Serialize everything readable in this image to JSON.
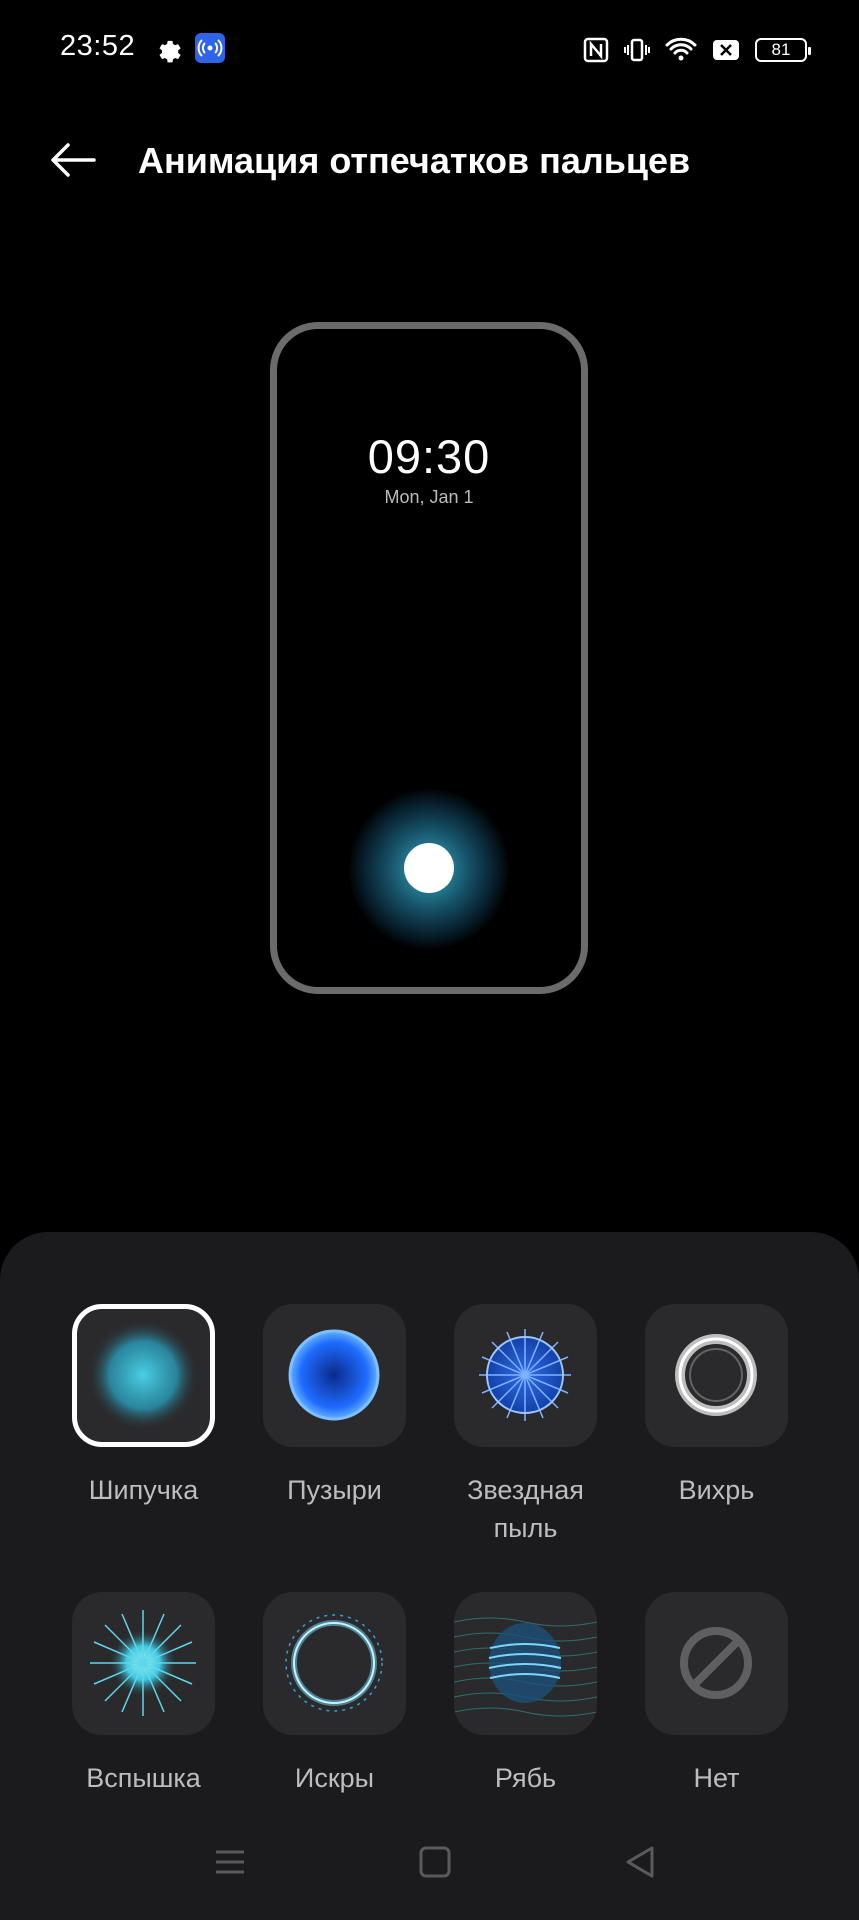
{
  "status_bar": {
    "time": "23:52",
    "battery": "81"
  },
  "header": {
    "title": "Анимация отпечатков пальцев"
  },
  "preview": {
    "time": "09:30",
    "date": "Mon, Jan 1"
  },
  "options": [
    {
      "label": "Шипучка",
      "icon": "fizz-animation-icon",
      "selected": true
    },
    {
      "label": "Пузыри",
      "icon": "bubble-animation-icon",
      "selected": false
    },
    {
      "label": "Звездная пыль",
      "icon": "stardust-animation-icon",
      "selected": false
    },
    {
      "label": "Вихрь",
      "icon": "vortex-animation-icon",
      "selected": false
    },
    {
      "label": "Вспышка",
      "icon": "flash-animation-icon",
      "selected": false
    },
    {
      "label": "Искры",
      "icon": "sparks-animation-icon",
      "selected": false
    },
    {
      "label": "Рябь",
      "icon": "ripple-animation-icon",
      "selected": false
    },
    {
      "label": "Нет",
      "icon": "none-icon",
      "selected": false
    }
  ],
  "colors": {
    "accent_cyan": "#3fc8e0",
    "hotspot_blue": "#2f63e8",
    "sheet_bg": "#1b1b1d"
  }
}
